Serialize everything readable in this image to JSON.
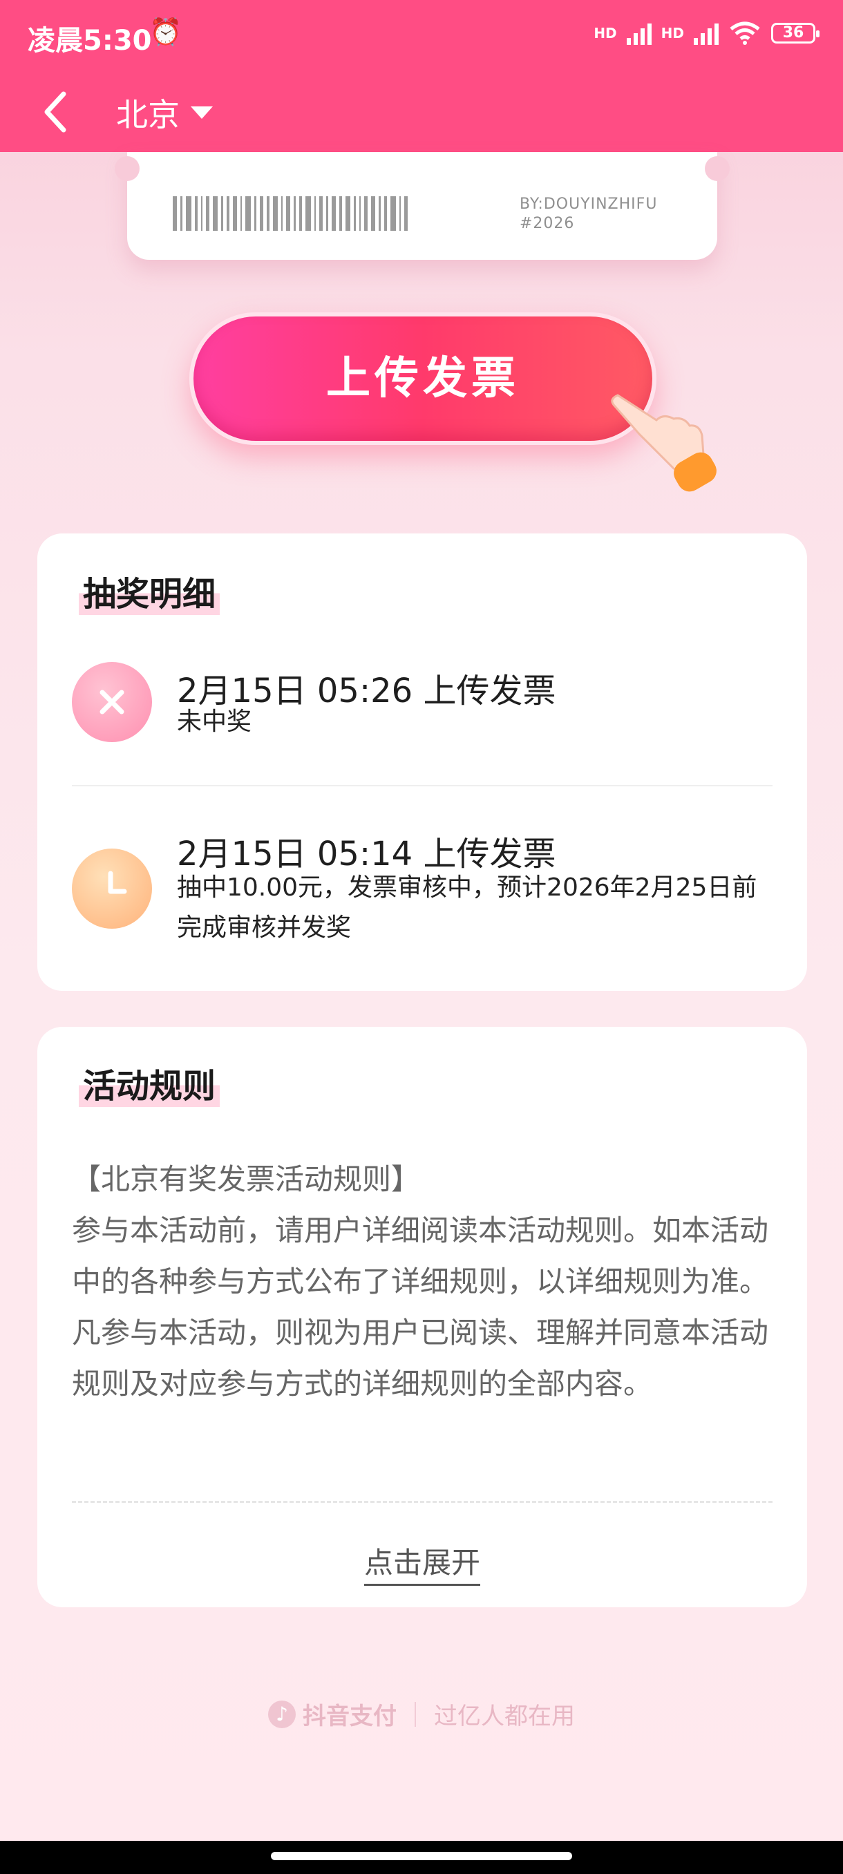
{
  "status_bar": {
    "time": "凌晨5:30",
    "battery": "36",
    "net1": "HD",
    "net2": "HD"
  },
  "header": {
    "city": "北京"
  },
  "ticket": {
    "line1": "BY:DOUYINZHIFU",
    "line2": "#2026"
  },
  "upload_button": {
    "label": "上传发票"
  },
  "draw_details": {
    "title": "抽奖明细",
    "items": [
      {
        "title": "2月15日 05:26 上传发票",
        "status": "未中奖",
        "icon": "close-icon",
        "color": "#ff8fb0"
      },
      {
        "title": "2月15日 05:14 上传发票",
        "status": "抽中10.00元，发票审核中，预计2026年2月25日前完成审核并发奖",
        "icon": "clock-icon",
        "color": "#ffb27a"
      }
    ]
  },
  "rules": {
    "title": "活动规则",
    "heading": "【北京有奖发票活动规则】",
    "body": "参与本活动前，请用户详细阅读本活动规则。如本活动中的各种参与方式公布了详细规则，以详细规则为准。凡参与本活动，则视为用户已阅读、理解并同意本活动规则及对应参与方式的详细规则的全部内容。",
    "expand_label": "点击展开"
  },
  "footer": {
    "brand": "抖音支付",
    "slogan": "过亿人都在用"
  },
  "colors": {
    "brand_pink": "#ff4d84"
  }
}
